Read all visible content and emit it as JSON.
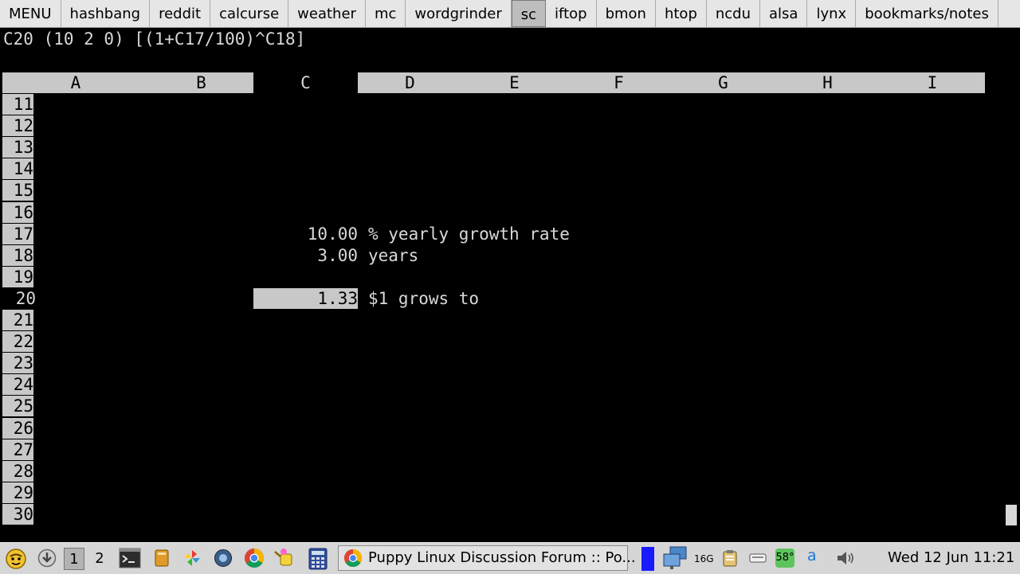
{
  "tabs": [
    {
      "label": "MENU"
    },
    {
      "label": "hashbang"
    },
    {
      "label": "reddit"
    },
    {
      "label": "calcurse"
    },
    {
      "label": "weather"
    },
    {
      "label": "mc"
    },
    {
      "label": "wordgrinder"
    },
    {
      "label": "sc",
      "active": true
    },
    {
      "label": "iftop"
    },
    {
      "label": "bmon"
    },
    {
      "label": "htop"
    },
    {
      "label": "ncdu"
    },
    {
      "label": "alsa"
    },
    {
      "label": "lynx"
    },
    {
      "label": "bookmarks/notes"
    }
  ],
  "sheet": {
    "formula_line": "C20 (10 2 0) [(1+C17/100)^C18]",
    "columns": [
      "A",
      "B",
      "C",
      "D",
      "E",
      "F",
      "G",
      "H",
      "I"
    ],
    "current_column": "C",
    "rows": [
      "11",
      "12",
      "13",
      "14",
      "15",
      "16",
      "17",
      "18",
      "19",
      "20",
      "21",
      "22",
      "23",
      "24",
      "25",
      "26",
      "27",
      "28",
      "29",
      "30"
    ],
    "current_row": "20",
    "cells": [
      {
        "row": "17",
        "value": "10.00",
        "label": "% yearly growth rate"
      },
      {
        "row": "18",
        "value": "3.00",
        "label": "years"
      },
      {
        "row": "20",
        "value": "1.33",
        "label": "$1 grows to",
        "selected": true
      }
    ]
  },
  "taskbar": {
    "desktop_1": "1",
    "desktop_2": "2",
    "window_title": "Puppy Linux Discussion Forum :: Po...",
    "tray_disk": "16G",
    "tray_temp": "58°",
    "tray_a": "a",
    "clock": "Wed 12 Jun 11:21"
  }
}
